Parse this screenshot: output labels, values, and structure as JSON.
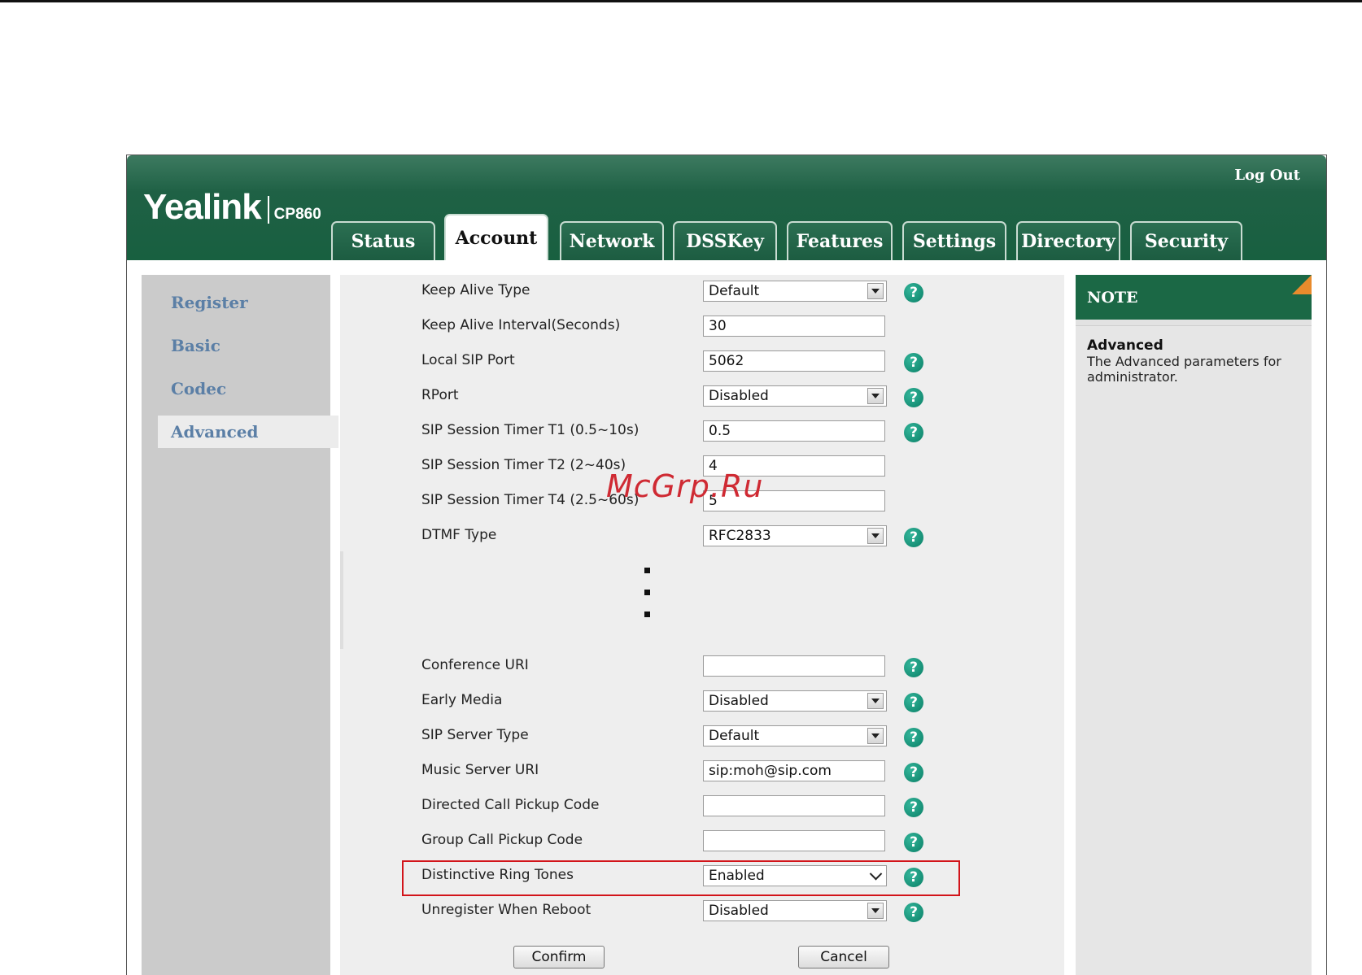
{
  "header": {
    "logo_word": "Yealink",
    "logo_model": "CP860",
    "logout": "Log Out"
  },
  "tabs": [
    "Status",
    "Account",
    "Network",
    "DSSKey",
    "Features",
    "Settings",
    "Directory",
    "Security"
  ],
  "active_tab": "Account",
  "sidebar": {
    "items": [
      "Register",
      "Basic",
      "Codec",
      "Advanced"
    ],
    "active": "Advanced"
  },
  "form": {
    "rows_top": [
      {
        "label": "Keep Alive Type",
        "type": "select",
        "value": "Default",
        "help": true
      },
      {
        "label": "Keep Alive Interval(Seconds)",
        "type": "input",
        "value": "30",
        "help": false
      },
      {
        "label": "Local SIP Port",
        "type": "input",
        "value": "5062",
        "help": true
      },
      {
        "label": "RPort",
        "type": "select",
        "value": "Disabled",
        "help": true
      },
      {
        "label": "SIP Session Timer T1 (0.5~10s)",
        "type": "input",
        "value": "0.5",
        "help": true
      },
      {
        "label": "SIP Session Timer T2 (2~40s)",
        "type": "input",
        "value": "4",
        "help": false
      },
      {
        "label": "SIP Session Timer T4 (2.5~60s)",
        "type": "input",
        "value": "5",
        "help": false
      },
      {
        "label": "DTMF Type",
        "type": "select",
        "value": "RFC2833",
        "help": true
      }
    ],
    "rows_bottom": [
      {
        "label": "Conference URI",
        "type": "input",
        "value": "",
        "help": true
      },
      {
        "label": "Early Media",
        "type": "select",
        "value": "Disabled",
        "help": true
      },
      {
        "label": "SIP Server Type",
        "type": "select",
        "value": "Default",
        "help": true
      },
      {
        "label": "Music Server URI",
        "type": "input",
        "value": "sip:moh@sip.com",
        "help": true
      },
      {
        "label": "Directed Call Pickup Code",
        "type": "input",
        "value": "",
        "help": true
      },
      {
        "label": "Group Call Pickup Code",
        "type": "input",
        "value": "",
        "help": true
      },
      {
        "label": "Distinctive Ring Tones",
        "type": "select-plain",
        "value": "Enabled",
        "help": true
      },
      {
        "label": "Unregister When Reboot",
        "type": "select",
        "value": "Disabled",
        "help": true
      }
    ],
    "confirm": "Confirm",
    "cancel": "Cancel",
    "help_glyph": "?"
  },
  "note": {
    "header": "NOTE",
    "title": "Advanced",
    "text": "The Advanced parameters for administrator."
  },
  "watermark": "McGrp.Ru",
  "colors": {
    "header_green": "#1f6145",
    "help_teal": "#0a7f66",
    "sidebar_link": "#5b7fa6",
    "highlight_red": "#d2141a",
    "note_corner": "#e98b2c"
  }
}
